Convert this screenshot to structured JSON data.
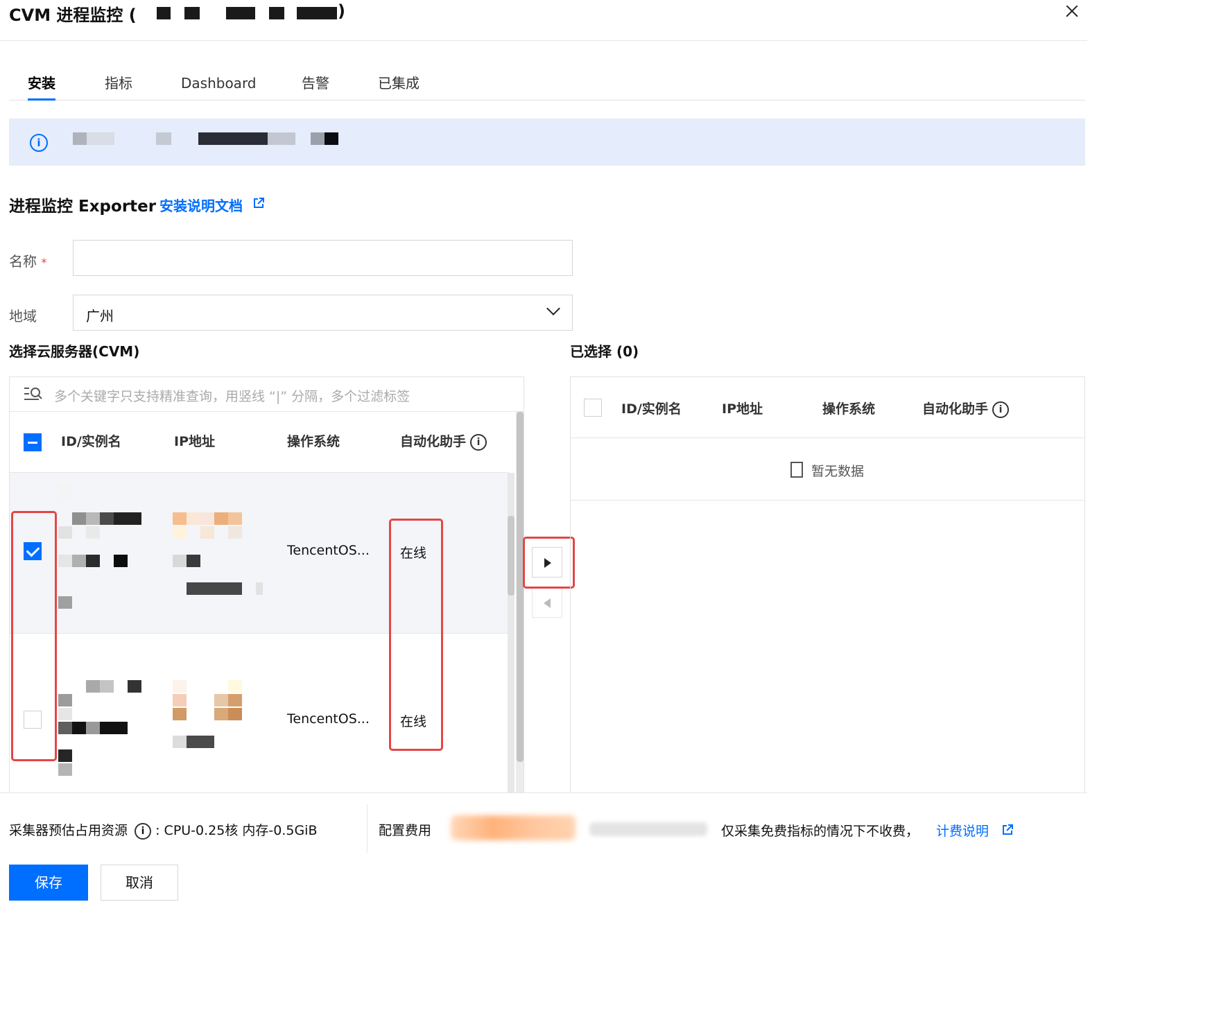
{
  "header": {
    "title": "CVM 进程监控 (",
    "title_close": ")"
  },
  "tabs": [
    {
      "label": "安装",
      "active": true
    },
    {
      "label": "指标"
    },
    {
      "label": "Dashboard"
    },
    {
      "label": "告警"
    },
    {
      "label": "已集成"
    }
  ],
  "section": {
    "title": "进程监控 Exporter",
    "doc_link": "安装说明文档"
  },
  "form": {
    "name_label": "名称",
    "name_required": "*",
    "name_value": "",
    "region_label": "地域",
    "region_value": "广州"
  },
  "left": {
    "title": "选择云服务器(CVM)",
    "search_placeholder": "多个关键字只支持精准查询，用竖线 “|” 分隔，多个过滤标签",
    "columns": [
      "ID/实例名",
      "IP地址",
      "操作系统",
      "自动化助手"
    ],
    "rows": [
      {
        "checked": true,
        "os": "TencentOS...",
        "agent": "在线"
      },
      {
        "checked": false,
        "os": "TencentOS...",
        "agent": "在线"
      }
    ]
  },
  "right": {
    "title": "已选择 (0)",
    "columns": [
      "ID/实例名",
      "IP地址",
      "操作系统",
      "自动化助手"
    ],
    "empty": "暂无数据"
  },
  "footer": {
    "resource_label": "采集器预估占用资源",
    "resource_value": ":   CPU-0.25核 内存-0.5GiB",
    "fee_label": "配置费用",
    "fee_note": "仅采集免费指标的情况下不收费，",
    "fee_link": "计费说明",
    "save": "保存",
    "cancel": "取消"
  },
  "colors": {
    "accent": "#006eff",
    "highlight": "#e54545",
    "banner": "#e5ecfb"
  }
}
